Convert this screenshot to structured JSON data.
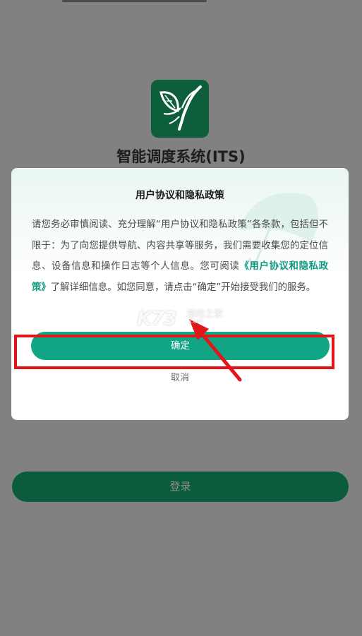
{
  "app": {
    "title": "智能调度系统(ITS)",
    "logo": "bird-leaf-logo"
  },
  "login": {
    "label": "登录"
  },
  "dialog": {
    "title": "用户协议和隐私政策",
    "body_part1": "请您务必审慎阅读、充分理解“用户协议和隐私政策”各条款，包括但不限于：为了向您提供导航、内容共享等服务，我们需要收集您的定位信息、设备信息和操作日志等个人信息。您可阅读",
    "link": "《用户协议和隐私政策》",
    "body_part2": "了解详细信息。如您同意，请点击“确定”开始接受我们的服务。",
    "confirm_label": "确定",
    "cancel_label": "取消"
  },
  "watermark": {
    "logo": "K73",
    "site": "游戏之家",
    "url": ".com"
  },
  "colors": {
    "overlay": "#818181",
    "accent": "#11a585",
    "logo_bg": "#0d5e3a",
    "annotation": "#e1161b"
  }
}
